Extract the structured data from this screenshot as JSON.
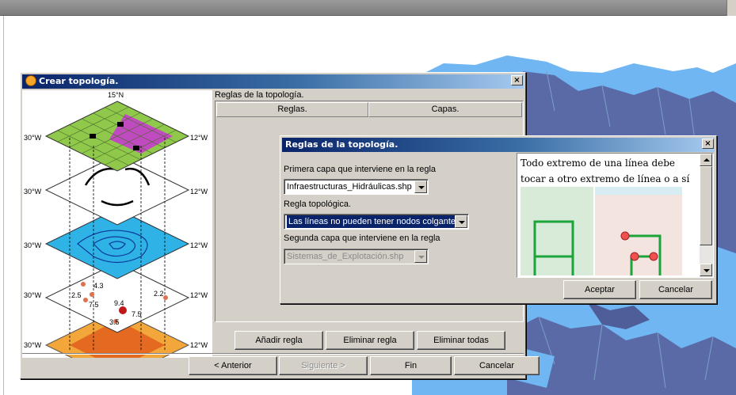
{
  "wizard": {
    "title": "Crear topología.",
    "close": "×",
    "rules_heading": "Reglas de la topología.",
    "columns": [
      "Reglas.",
      "Capas."
    ],
    "buttons": {
      "add_rule": "Añadir regla",
      "remove_rule": "Eliminar regla",
      "remove_all": "Eliminar todas",
      "back": "< Anterior",
      "next": "Siguiente >",
      "finish": "Fin",
      "cancel": "Cancelar"
    },
    "illustration": {
      "top_label": "15°N",
      "left_labels": [
        "30°W",
        "30°W",
        "30°W",
        "30°W",
        "30°W"
      ],
      "right_labels": [
        "12°W",
        "12°W",
        "12°W",
        "12°W",
        "12°W"
      ],
      "values": [
        "4.3",
        "2.5",
        "7.5",
        "9.4",
        "7.5",
        "3.5",
        "2.2"
      ]
    }
  },
  "rule_dialog": {
    "title": "Reglas de la topología.",
    "close": "×",
    "first_layer_label": "Primera capa que interviene en la regla",
    "first_layer_value": "Infraestructuras_Hidráulicas.shp",
    "rule_label": "Regla topológica.",
    "rule_value": "Las líneas no pueden tener nodos colgantes",
    "second_layer_label": "Segunda capa que interviene en la regla",
    "second_layer_value": "Sistemas_de_Explotación.shp",
    "description": "Todo extremo de una línea debe tocar a otro extremo de línea o a sí mismo.",
    "accept": "Aceptar",
    "cancel": "Cancelar"
  },
  "colors": {
    "map_water": "#6fb6f2",
    "map_land": "#5a6aa6",
    "title_start": "#0a246a",
    "title_end": "#a6caf0",
    "dialog_face": "#d4d0c8"
  }
}
